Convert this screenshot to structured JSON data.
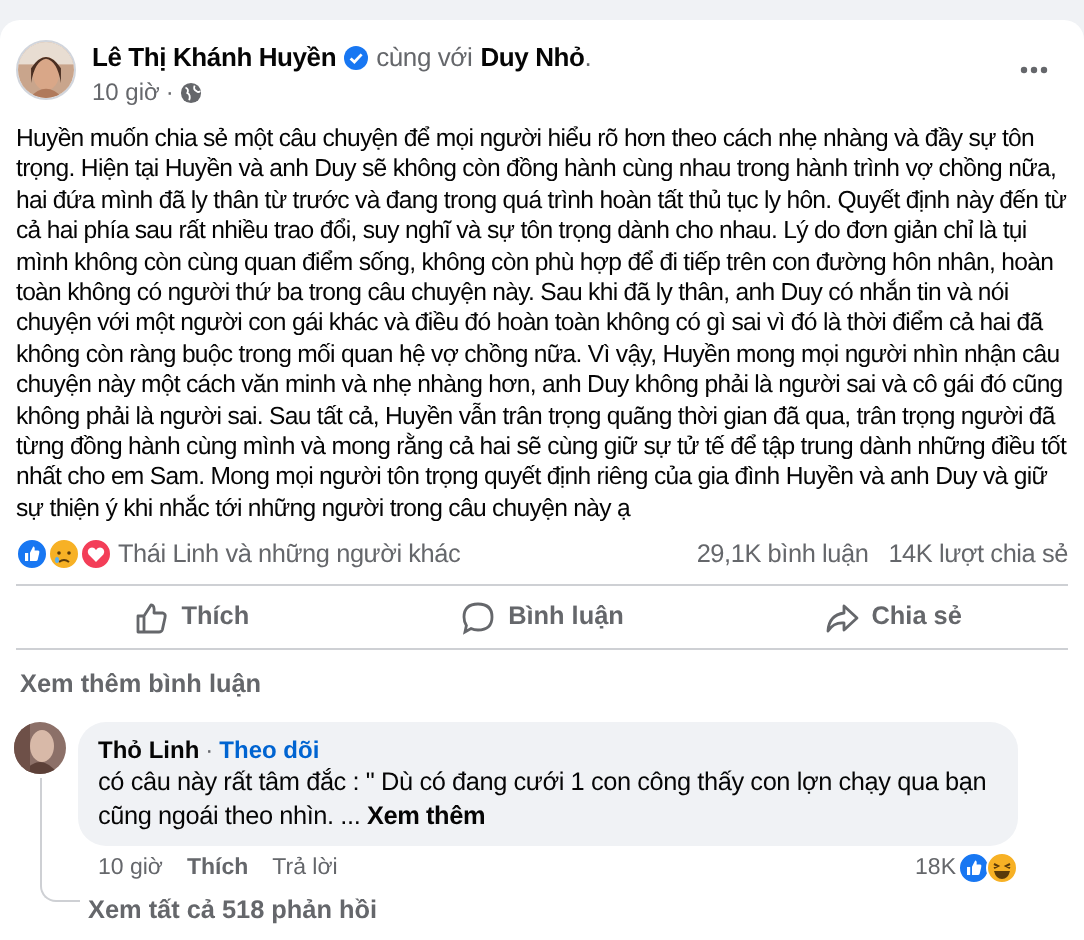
{
  "post": {
    "author": "Lê Thị Khánh Huyền",
    "verified": true,
    "with_text": "cùng với",
    "tagged": "Duy Nhỏ",
    "tagged_suffix": ".",
    "time": "10 giờ",
    "separator": "·",
    "body": "Huyền muốn chia sẻ một câu chuyện để mọi người hiểu rõ hơn theo cách nhẹ nhàng và đầy sự tôn trọng. Hiện tại Huyền và anh Duy sẽ không còn đồng hành cùng nhau trong hành trình vợ chồng nữa, hai đứa mình đã ly thân từ trước và đang trong quá trình hoàn tất thủ tục ly hôn. Quyết định này đến từ cả hai phía sau rất nhiều trao đổi, suy nghĩ và sự tôn trọng dành cho nhau. Lý do đơn giản chỉ là tụi mình không còn cùng quan điểm sống, không còn phù hợp để đi tiếp trên con đường hôn nhân, hoàn toàn không có người thứ ba trong câu chuyện này. Sau khi đã ly thân, anh Duy có nhắn tin và nói chuyện với một người con gái khác và điều đó hoàn toàn không có gì sai vì đó là thời điểm cả hai đã không còn ràng buộc trong mối quan hệ vợ chồng nữa. Vì vậy, Huyền mong mọi người nhìn nhận câu chuyện này một cách văn minh và nhẹ nhàng hơn, anh Duy không phải là người sai và cô gái đó cũng không phải là người sai. Sau tất cả, Huyền vẫn trân trọng quãng thời gian đã qua, trân trọng người đã từng đồng hành cùng mình và mong rằng cả hai sẽ cùng giữ sự tử tế để tập trung dành những điều tốt nhất cho em Sam. Mong mọi người tôn trọng quyết định riêng của gia đình Huyền và anh Duy và giữ sự thiện ý khi nhắc tới những người trong câu chuyện này ạ"
  },
  "reactions": {
    "icons": [
      {
        "kind": "like"
      },
      {
        "kind": "sad"
      },
      {
        "kind": "love"
      }
    ],
    "names": "Thái Linh và những người khác",
    "comments": "29,1K bình luận",
    "shares": "14K lượt chia sẻ"
  },
  "actions": [
    {
      "kind": "like",
      "label": "Thích"
    },
    {
      "kind": "comment",
      "label": "Bình luận"
    },
    {
      "kind": "share",
      "label": "Chia sẻ"
    }
  ],
  "more_comments": "Xem thêm bình luận",
  "comment": {
    "author": "Thỏ Linh",
    "separator": "·",
    "follow": "Theo dõi",
    "text": "có câu này rất tâm đắc : \" Dù có đang cưới 1 con công thấy con lợn chạy qua bạn cũng ngoái theo nhìn. ...",
    "more": "Xem thêm",
    "time": "10 giờ",
    "like": "Thích",
    "reply": "Trả lời",
    "count": "18K",
    "reaction_icons": [
      {
        "kind": "like"
      },
      {
        "kind": "haha"
      }
    ],
    "view_replies": "Xem tất cả 518 phản hồi"
  }
}
